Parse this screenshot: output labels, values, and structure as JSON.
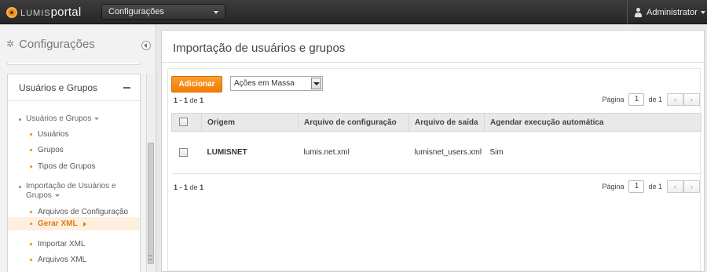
{
  "topbar": {
    "logo_lumis": "LUMIS",
    "logo_portal": "portal",
    "context_select": "Configurações",
    "user": "Administrator"
  },
  "sidebar": {
    "title": "Configurações",
    "section": "Usuários e Grupos",
    "groups": [
      {
        "label": "Usuários e Grupos",
        "items": [
          "Usuários",
          "Grupos",
          "Tipos de Grupos"
        ]
      },
      {
        "label": "Importação de Usuários e Grupos",
        "items": [
          "Arquivos de Configuração",
          "Gerar XML",
          "Importar XML",
          "Arquivos XML"
        ]
      }
    ],
    "active_item": "Gerar XML"
  },
  "main": {
    "title": "Importação de usuários e grupos",
    "add_button": "Adicionar",
    "bulk_actions": "Ações em Massa",
    "range_top": {
      "from_to": "1 - 1",
      "of": "de",
      "total": "1"
    },
    "range_bottom": {
      "from_to": "1 - 1",
      "of": "de",
      "total": "1"
    },
    "pager": {
      "label": "Página",
      "page": "1",
      "of": "de 1",
      "prev": "‹",
      "next": "›"
    },
    "columns": [
      "Origem",
      "Arquivo de configuração",
      "Arquivo de saída",
      "Agendar execução automática"
    ],
    "rows": [
      {
        "origem": "LUMISNET",
        "config": "lumis.net.xml",
        "saida": "lumisnet_users.xml",
        "agendar": "Sim"
      }
    ]
  }
}
